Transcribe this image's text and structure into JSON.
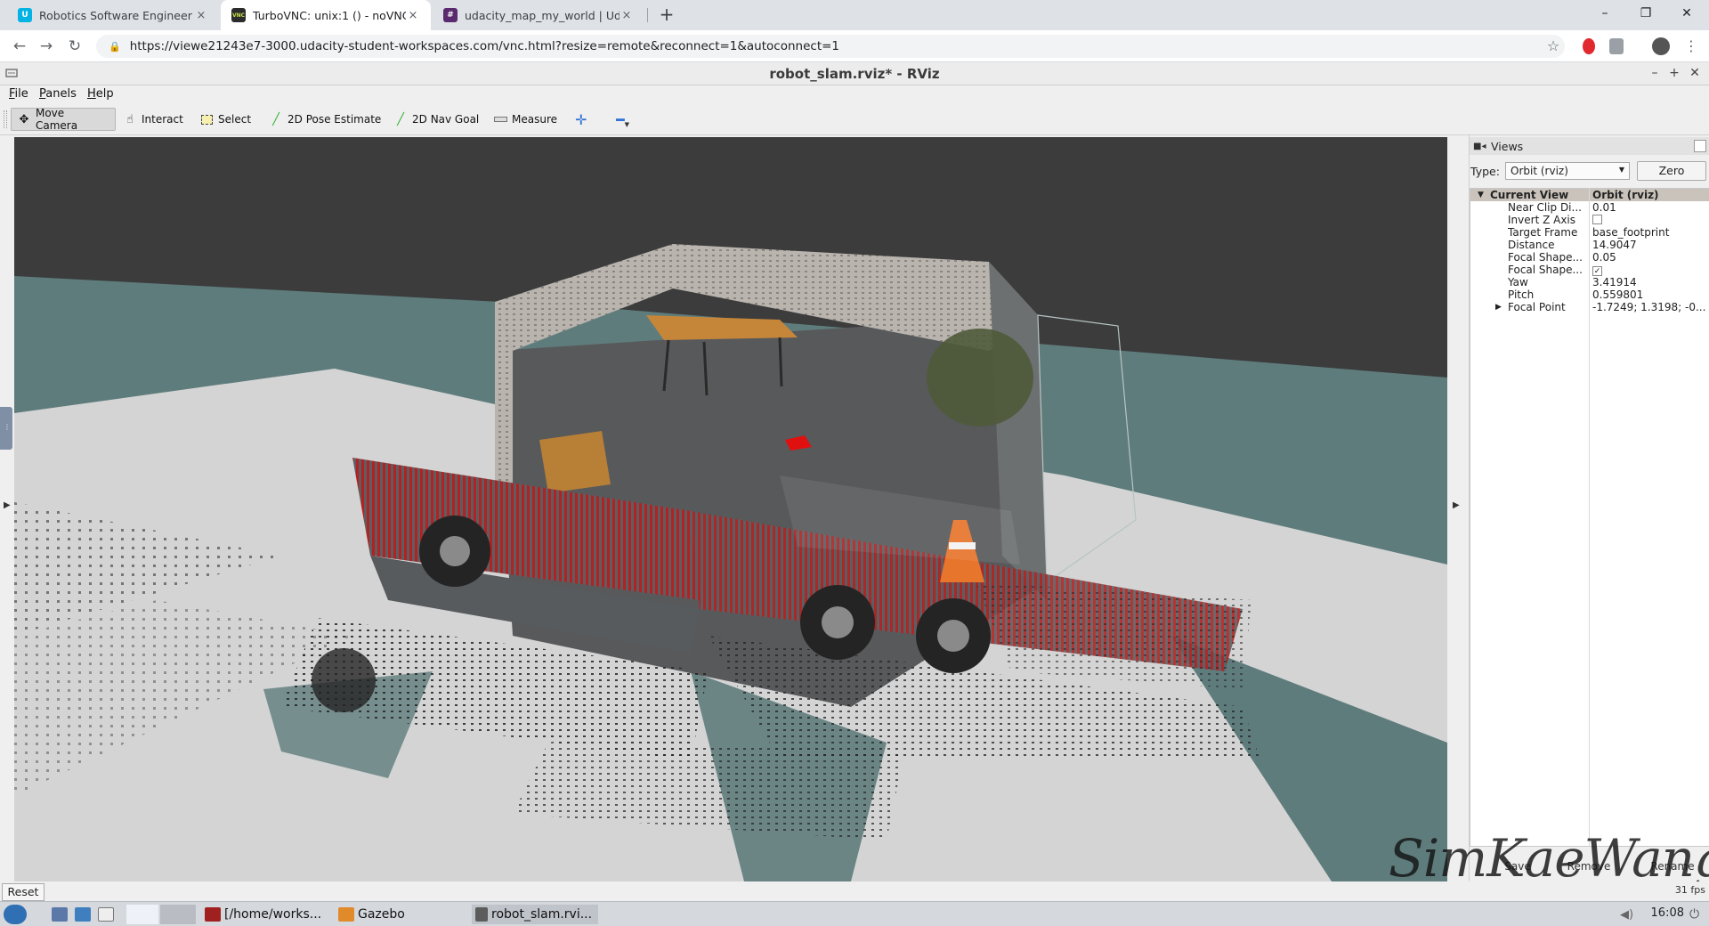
{
  "browser": {
    "tabs": [
      {
        "title": "Robotics Software Engineer - Uda",
        "favicon_color": "#02b3e4",
        "favicon_glyph": "U"
      },
      {
        "title": "TurboVNC: unix:1 () - noVNC",
        "favicon_color": "#2b2b2b",
        "favicon_glyph": "VNC"
      },
      {
        "title": "udacity_map_my_world | Udacity",
        "favicon_color": "#5a2a6e",
        "favicon_glyph": "#"
      }
    ],
    "tab_close": "×",
    "new_tab": "+",
    "window_controls": {
      "minimize": "–",
      "maximize": "❐",
      "close": "✕"
    },
    "url": "https://viewe21243e7-3000.udacity-student-workspaces.com/vnc.html?resize=remote&reconnect=1&autoconnect=1"
  },
  "rviz": {
    "window_title": "robot_slam.rviz* - RViz",
    "window_controls": {
      "minimize": "–",
      "maximize": "+",
      "close": "✕"
    },
    "menu": {
      "file": "ile",
      "file_mnemonic": "F",
      "panels": "anels",
      "panels_mnemonic": "P",
      "help": "elp",
      "help_mnemonic": "H"
    },
    "toolbar": [
      {
        "label": "Move Camera",
        "icon": "move-camera-icon",
        "active": true
      },
      {
        "label": "Interact",
        "icon": "hand-icon",
        "active": false
      },
      {
        "label": "Select",
        "icon": "select-box-icon",
        "active": false
      },
      {
        "label": "2D Pose Estimate",
        "icon": "pose-arrow-icon",
        "active": false
      },
      {
        "label": "2D Nav Goal",
        "icon": "nav-goal-arrow-icon",
        "active": false
      },
      {
        "label": "Measure",
        "icon": "ruler-icon",
        "active": false
      }
    ],
    "views_panel": {
      "title": "Views",
      "type_label": "Type:",
      "type_value": "Orbit (rviz)",
      "zero_button": "Zero",
      "current_view": {
        "name": "Current View",
        "value": "Orbit (rviz)"
      },
      "properties": [
        {
          "name": "Near Clip Di...",
          "value": "0.01"
        },
        {
          "name": "Invert Z Axis",
          "value": "",
          "checkbox": false
        },
        {
          "name": "Target Frame",
          "value": "base_footprint"
        },
        {
          "name": "Distance",
          "value": "14.9047"
        },
        {
          "name": "Focal Shape...",
          "value": "0.05"
        },
        {
          "name": "Focal Shape...",
          "value": "",
          "checkbox": true
        },
        {
          "name": "Yaw",
          "value": "3.41914"
        },
        {
          "name": "Pitch",
          "value": "0.559801"
        },
        {
          "name": "Focal Point",
          "value": "-1.7249; 1.3198; -0...",
          "expandable": true
        }
      ],
      "buttons": {
        "save": "Save",
        "remove": "Remove",
        "rename": "Rename"
      }
    },
    "reset_button": "Reset",
    "fps": "31 fps",
    "watermark": "SimKaeWang"
  },
  "taskbar": {
    "items": [
      {
        "label": "[/home/works...",
        "icon_color": "#a02020"
      },
      {
        "label": "Gazebo",
        "icon_color": "#e08a2a"
      },
      {
        "label": "robot_slam.rvi...",
        "icon_color": "#5c5c5c"
      }
    ],
    "clock": "16:08"
  }
}
